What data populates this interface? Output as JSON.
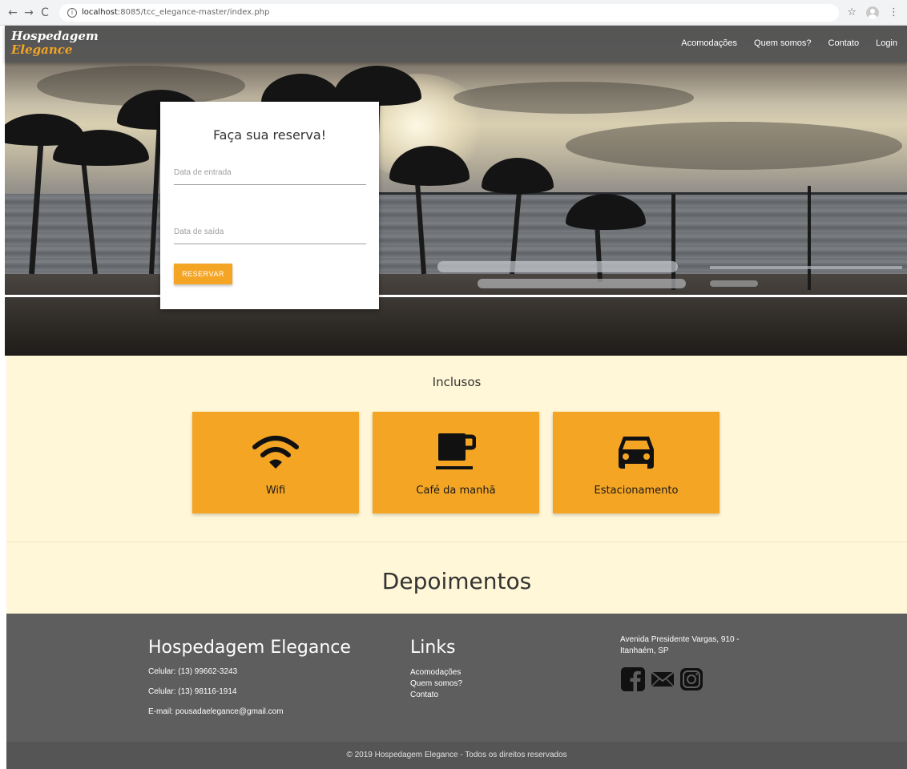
{
  "browser": {
    "back_icon": "←",
    "forward_icon": "→",
    "reload_icon": "C",
    "url_host": "localhost",
    "url_path": ":8085/tcc_elegance-master/index.php",
    "star_icon": "☆",
    "menu_icon": "⋮"
  },
  "brand": {
    "line1": "Hospedagem",
    "line2": "Elegance"
  },
  "nav": {
    "items": [
      "Acomodações",
      "Quem somos?",
      "Contato",
      "Login"
    ]
  },
  "reservation": {
    "title": "Faça sua reserva!",
    "checkin_placeholder": "Data de entrada",
    "checkout_placeholder": "Data de saída",
    "button_label": "RESERVAR"
  },
  "inclusos": {
    "title": "Inclusos",
    "items": [
      {
        "label": "Wifi",
        "icon": "wifi-icon"
      },
      {
        "label": "Café da manhã",
        "icon": "coffee-cup-icon"
      },
      {
        "label": "Estacionamento",
        "icon": "car-icon"
      }
    ]
  },
  "depoimentos": {
    "title": "Depoimentos"
  },
  "footer": {
    "company": "Hospedagem Elegance",
    "phone1": "Celular: (13) 99662-3243",
    "phone2": "Celular: (13) 98116-1914",
    "email": "E-mail: pousadaelegance@gmail.com",
    "links_title": "Links",
    "links": [
      "Acomodações",
      "Quem somos?",
      "Contato"
    ],
    "address_line1": "Avenida Presidente Vargas, 910 -",
    "address_line2": "Itanhaém, SP",
    "social": [
      "facebook-icon",
      "mail-icon",
      "instagram-icon"
    ],
    "copyright": "© 2019 Hospedagem Elegance - Todos os direitos reservados"
  },
  "colors": {
    "accent": "#f4a524",
    "cream": "#fff7d7",
    "footer": "#5e5e5e"
  }
}
